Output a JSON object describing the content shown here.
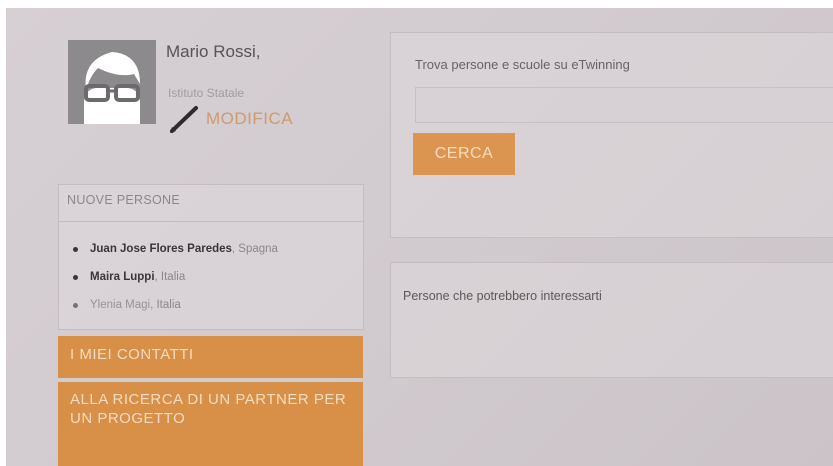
{
  "profile": {
    "name": "Mario Rossi,",
    "school": "Istituto Statale",
    "edit_label": "MODIFICA"
  },
  "new_people": {
    "title": "NUOVE PERSONE",
    "items": [
      {
        "name": "Juan Jose Flores Paredes",
        "country": ", Spagna"
      },
      {
        "name": "Maira Luppi",
        "country": ", Italia"
      },
      {
        "name": "Ylenia Magi",
        "country": ", Italia"
      }
    ]
  },
  "nav": {
    "contacts_label": "I MIEI CONTATTI",
    "partner_label": "ALLA RICERCA DI UN PARTNER PER UN PROGETTO"
  },
  "search": {
    "label": "Trova persone e scuole su eTwinning",
    "input_value": "",
    "button_label": "CERCA"
  },
  "suggestions": {
    "label": "Persone che potrebbero interessarti"
  },
  "colors": {
    "accent": "#d88f47",
    "background": "#d2cbcf"
  }
}
